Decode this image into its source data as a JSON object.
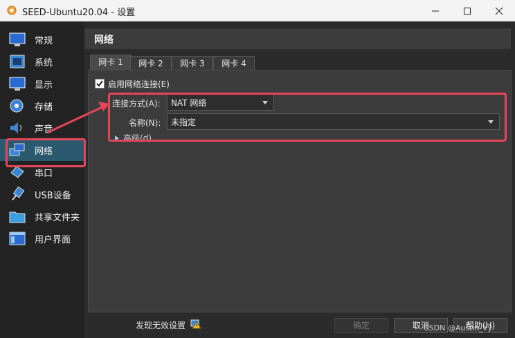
{
  "window": {
    "title": "SEED-Ubuntu20.04 - 设置"
  },
  "sidebar": {
    "items": [
      {
        "label": "常规",
        "icon": "general-icon"
      },
      {
        "label": "系统",
        "icon": "system-icon"
      },
      {
        "label": "显示",
        "icon": "display-icon"
      },
      {
        "label": "存储",
        "icon": "storage-icon"
      },
      {
        "label": "声音",
        "icon": "audio-icon"
      },
      {
        "label": "网络",
        "icon": "network-icon",
        "selected": true
      },
      {
        "label": "串口",
        "icon": "serial-icon"
      },
      {
        "label": "USB设备",
        "icon": "usb-icon"
      },
      {
        "label": "共享文件夹",
        "icon": "shared-folder-icon"
      },
      {
        "label": "用户界面",
        "icon": "ui-icon"
      }
    ]
  },
  "header": {
    "title": "网络"
  },
  "tabs": [
    {
      "label": "网卡 1",
      "active": true
    },
    {
      "label": "网卡 2"
    },
    {
      "label": "网卡 3"
    },
    {
      "label": "网卡 4"
    }
  ],
  "adapter": {
    "enable_label": "启用网络连接(E)",
    "enabled": true,
    "attached_label": "连接方式(A):",
    "attached_value": "NAT 网络",
    "name_label": "名称(N):",
    "name_value": "未指定",
    "advanced_label": "高级(d)"
  },
  "footer": {
    "warning_label": "发现无效设置",
    "ok_label": "确定",
    "cancel_label": "取消",
    "help_label": "帮助(H)"
  },
  "watermark": "CSDN @Austin_Yy",
  "colors": {
    "highlight": "#e8455a",
    "selection": "#2b5a6f"
  }
}
